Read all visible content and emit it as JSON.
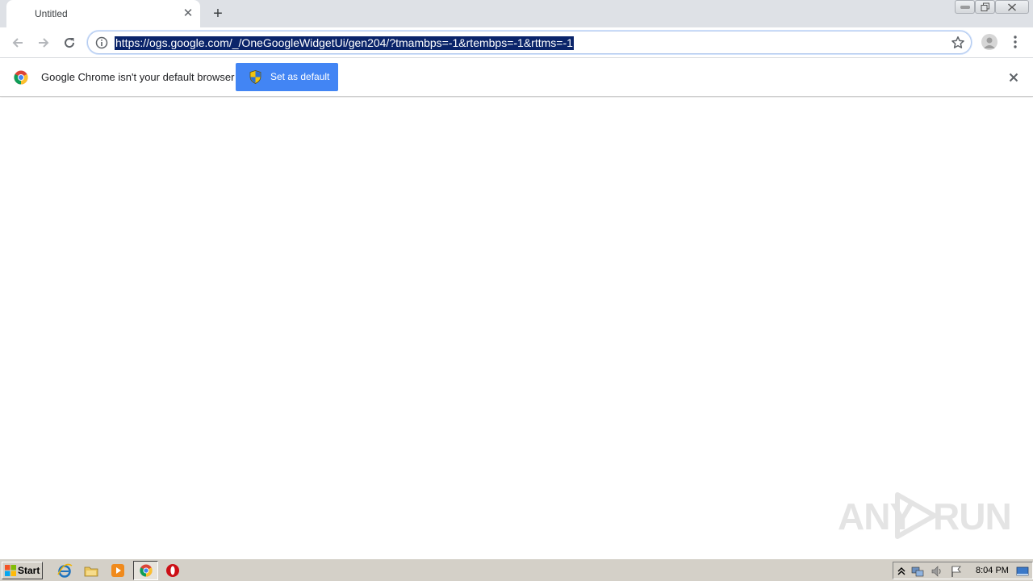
{
  "tab": {
    "title": "Untitled"
  },
  "omnibox": {
    "url": "https://ogs.google.com/_/OneGoogleWidgetUi/gen204/?tmambps=-1&rtembps=-1&rttms=-1"
  },
  "infobar": {
    "message": "Google Chrome isn't your default browser",
    "button_label": "Set as default"
  },
  "watermark": {
    "text_left": "ANY",
    "text_right": "RUN"
  },
  "taskbar": {
    "start_label": "Start",
    "clock": "8:04 PM"
  },
  "colors": {
    "tabstrip": "#dee1e6",
    "accent_button": "#4285f4",
    "url_selection": "#0a246a",
    "taskbar": "#d4d0c8"
  }
}
